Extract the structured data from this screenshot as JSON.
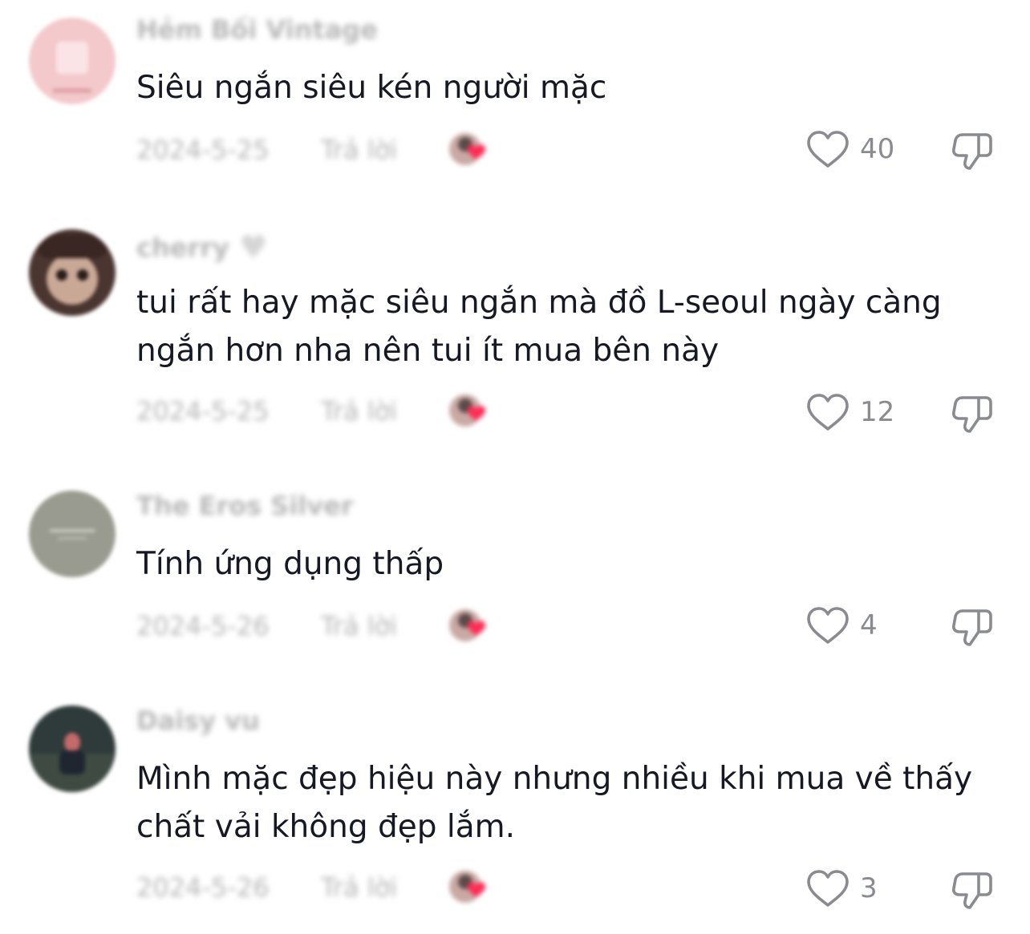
{
  "comments": [
    {
      "username": "Hẻm Bối Vintage",
      "text": "Siêu ngắn siêu kén người mặc",
      "date": "2024-5-25",
      "reply_label": "Trả lời",
      "likes": "40",
      "avatar_color": "#f3c9cc"
    },
    {
      "username": "cherry",
      "text": "tui rất hay mặc siêu ngắn mà đồ L-seoul ngày càng ngắn hơn nha nên tui ít mua bên này",
      "date": "2024-5-25",
      "reply_label": "Trả lời",
      "likes": "12",
      "avatar_color": "#4a3530"
    },
    {
      "username": "The Eros Silver",
      "text": "Tính ứng dụng thấp",
      "date": "2024-5-26",
      "reply_label": "Trả lời",
      "likes": "4",
      "avatar_color": "#9a9b90"
    },
    {
      "username": "Daisy vu",
      "text": "Mình mặc đẹp hiệu này nhưng nhiều khi mua về thấy chất vải không đẹp lắm.",
      "date": "2024-5-26",
      "reply_label": "Trả lời",
      "likes": "3",
      "avatar_color": "#2f3a3a"
    }
  ],
  "icons": {
    "like": "heart-outline-icon",
    "dislike": "thumbs-down-icon",
    "creator_liked": "creator-liked-avatar-icon"
  },
  "colors": {
    "text": "#161823",
    "muted": "#8a8b91",
    "heart_red": "#fe2c55"
  }
}
